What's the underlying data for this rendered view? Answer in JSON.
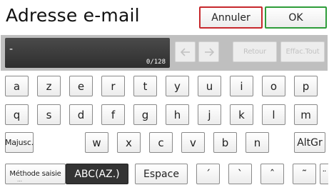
{
  "title": "Adresse e-mail",
  "buttons": {
    "cancel": "Annuler",
    "ok": "OK"
  },
  "entry": {
    "value": "-",
    "counter": "0/128"
  },
  "edit_keys": {
    "back_label": "Retour",
    "clear_all_label": "Effac.Tout"
  },
  "keyboard": {
    "row1": [
      "a",
      "z",
      "e",
      "r",
      "t",
      "y",
      "u",
      "i",
      "o",
      "p"
    ],
    "row2": [
      "q",
      "s",
      "d",
      "f",
      "g",
      "h",
      "j",
      "k",
      "l",
      "m"
    ],
    "row3_letters": [
      "w",
      "x",
      "c",
      "v",
      "b",
      "n"
    ],
    "shift_label": "Majusc.",
    "altgr_label": "AltGr",
    "input_method_label": "Méthode saisie",
    "input_mode_value": "ABC(AZ.)",
    "space_label": "Espace",
    "accents": [
      "´",
      "`",
      "ˆ",
      "˜",
      "¨"
    ]
  },
  "colors": {
    "cancel_border": "#c6282c",
    "ok_border": "#2e9d3a",
    "field_bg": "#333333"
  }
}
